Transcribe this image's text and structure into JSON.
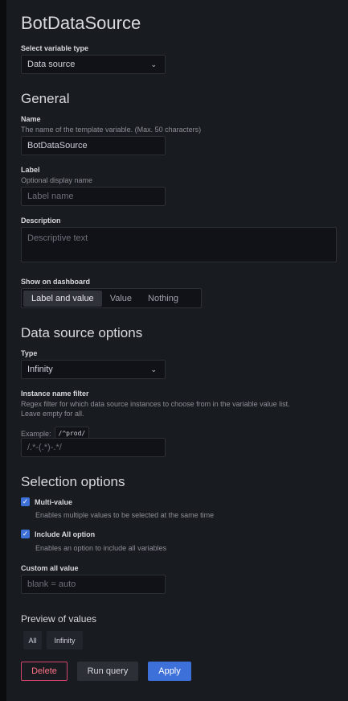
{
  "header": {
    "title": "BotDataSource"
  },
  "variable_type": {
    "label": "Select variable type",
    "value": "Data source"
  },
  "general": {
    "heading": "General",
    "name": {
      "label": "Name",
      "description": "The name of the template variable. (Max. 50 characters)",
      "value": "BotDataSource"
    },
    "label_field": {
      "label": "Label",
      "description": "Optional display name",
      "placeholder": "Label name"
    },
    "description": {
      "label": "Description",
      "placeholder": "Descriptive text"
    },
    "show_on_dashboard": {
      "label": "Show on dashboard",
      "options": [
        "Label and value",
        "Value",
        "Nothing"
      ],
      "selected": "Label and value"
    }
  },
  "datasource_options": {
    "heading": "Data source options",
    "type": {
      "label": "Type",
      "value": "Infinity"
    },
    "instance_filter": {
      "label": "Instance name filter",
      "description": "Regex filter for which data source instances to choose from in the variable value list. Leave empty for all.",
      "example_label": "Example:",
      "example_code": "/^prod/",
      "placeholder": "/.*-(.*)-.*/"
    }
  },
  "selection_options": {
    "heading": "Selection options",
    "multi_value": {
      "label": "Multi-value",
      "description": "Enables multiple values to be selected at the same time",
      "checked": true
    },
    "include_all": {
      "label": "Include All option",
      "description": "Enables an option to include all variables",
      "checked": true
    },
    "custom_all": {
      "label": "Custom all value",
      "placeholder": "blank = auto"
    }
  },
  "preview": {
    "heading": "Preview of values",
    "values": [
      "All",
      "Infinity"
    ]
  },
  "actions": {
    "delete": "Delete",
    "run_query": "Run query",
    "apply": "Apply"
  },
  "icons": {
    "chevron": "chevron-down-icon",
    "check": "check-icon"
  },
  "colors": {
    "background": "#181b1f",
    "primary": "#3d71d9",
    "danger": "#d1456b"
  }
}
